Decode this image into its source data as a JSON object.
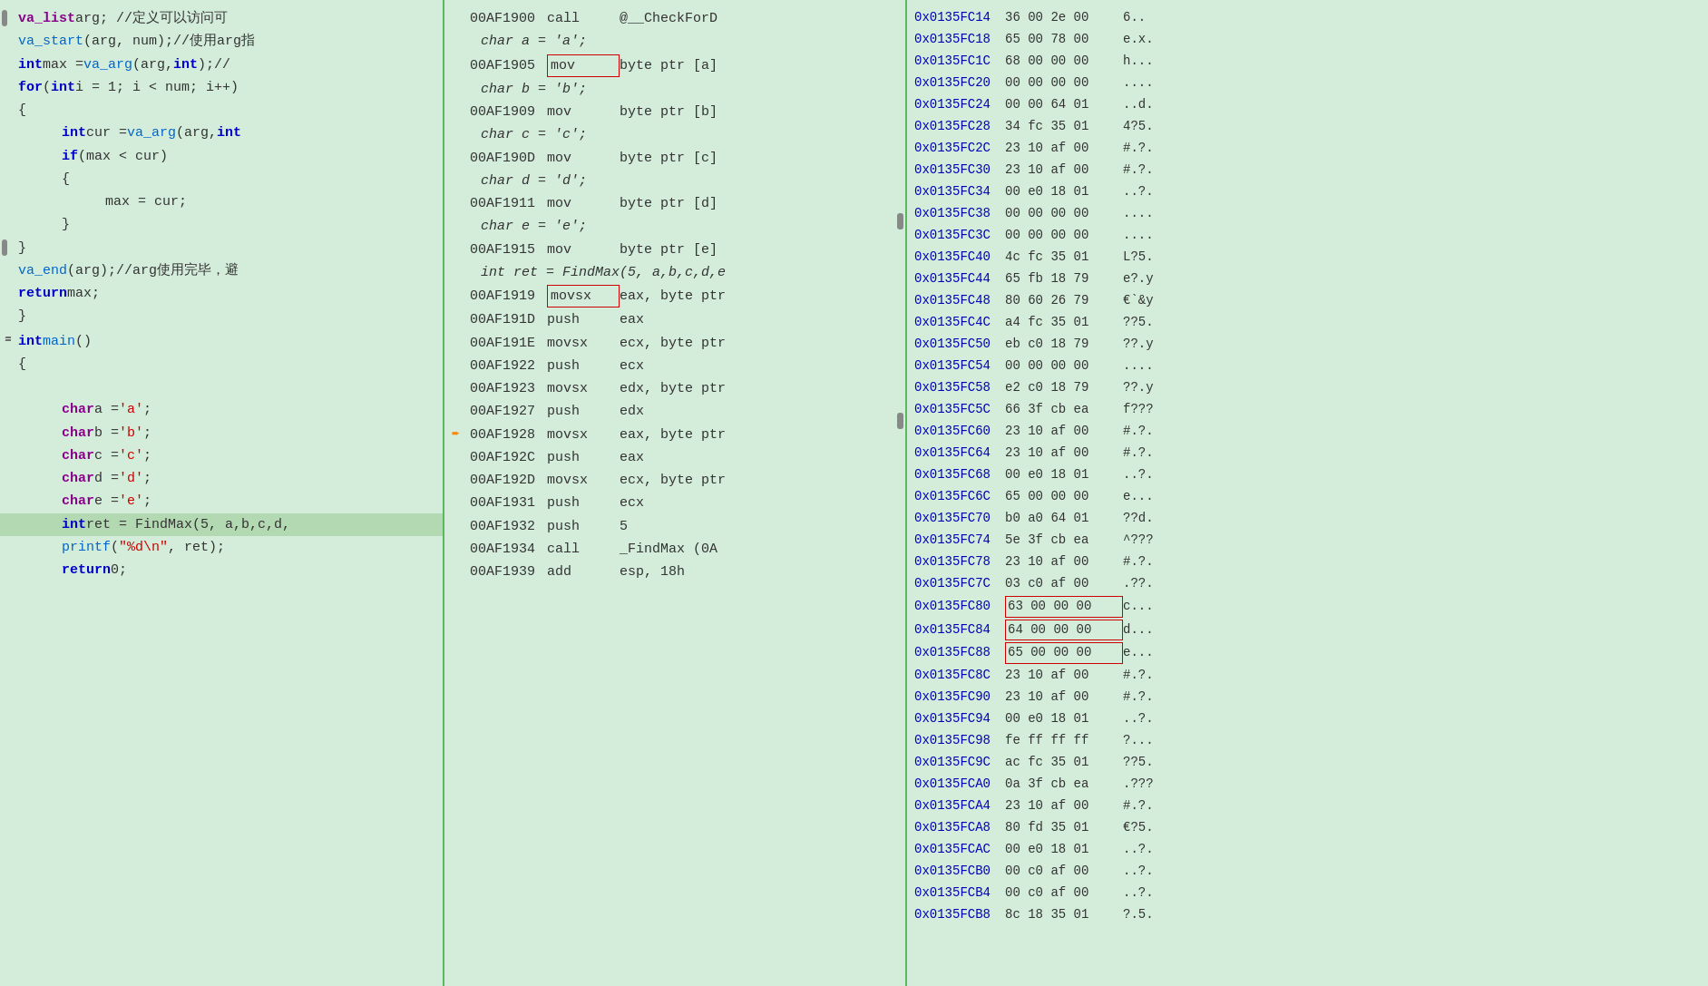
{
  "left": {
    "lines": [
      {
        "id": 1,
        "indent": 0,
        "tokens": [
          {
            "t": "kw2",
            "v": "va_list"
          },
          {
            "t": "plain",
            "v": " arg;   //定义可以访问可"
          }
        ]
      },
      {
        "id": 2,
        "indent": 0,
        "tokens": [
          {
            "t": "fn",
            "v": "va_start"
          },
          {
            "t": "plain",
            "v": "(arg, num);//使用arg指"
          }
        ]
      },
      {
        "id": 3,
        "indent": 0,
        "tokens": [
          {
            "t": "kw",
            "v": "int"
          },
          {
            "t": "plain",
            "v": " max = "
          },
          {
            "t": "fn",
            "v": "va_arg"
          },
          {
            "t": "plain",
            "v": "(arg, "
          },
          {
            "t": "kw",
            "v": "int"
          },
          {
            "t": "plain",
            "v": ");//"
          }
        ]
      },
      {
        "id": 4,
        "indent": 0,
        "tokens": [
          {
            "t": "kw",
            "v": "for"
          },
          {
            "t": "plain",
            "v": " ("
          },
          {
            "t": "kw",
            "v": "int"
          },
          {
            "t": "plain",
            "v": " i = 1; i < num; i++)"
          }
        ]
      },
      {
        "id": 5,
        "indent": 0,
        "tokens": [
          {
            "t": "plain",
            "v": "{"
          }
        ]
      },
      {
        "id": 6,
        "indent": 3,
        "tokens": [
          {
            "t": "kw",
            "v": "int"
          },
          {
            "t": "plain",
            "v": " cur = "
          },
          {
            "t": "fn",
            "v": "va_arg"
          },
          {
            "t": "plain",
            "v": "(arg, "
          },
          {
            "t": "kw",
            "v": "int"
          }
        ]
      },
      {
        "id": 7,
        "indent": 3,
        "tokens": [
          {
            "t": "kw",
            "v": "if"
          },
          {
            "t": "plain",
            "v": " (max < cur)"
          }
        ]
      },
      {
        "id": 8,
        "indent": 3,
        "tokens": [
          {
            "t": "plain",
            "v": "{"
          }
        ]
      },
      {
        "id": 9,
        "indent": 6,
        "tokens": [
          {
            "t": "plain",
            "v": "max = cur;"
          }
        ]
      },
      {
        "id": 10,
        "indent": 3,
        "tokens": [
          {
            "t": "plain",
            "v": "}"
          }
        ]
      },
      {
        "id": 11,
        "indent": 0,
        "tokens": [
          {
            "t": "plain",
            "v": "}"
          }
        ]
      },
      {
        "id": 12,
        "indent": 0,
        "tokens": [
          {
            "t": "fn",
            "v": "va_end"
          },
          {
            "t": "plain",
            "v": "(arg);//arg使用完毕，避"
          }
        ]
      },
      {
        "id": 13,
        "indent": 0,
        "tokens": [
          {
            "t": "kw",
            "v": "return"
          },
          {
            "t": "plain",
            "v": " max;"
          }
        ]
      },
      {
        "id": 14,
        "indent": 0,
        "tokens": [
          {
            "t": "plain",
            "v": "}"
          }
        ]
      },
      {
        "id": 15,
        "indent": 0,
        "tokens": []
      },
      {
        "id": 16,
        "indent": 0,
        "gutter": "=",
        "tokens": [
          {
            "t": "kw",
            "v": "int"
          },
          {
            "t": "plain",
            "v": " "
          },
          {
            "t": "fn",
            "v": "main"
          },
          {
            "t": "plain",
            "v": "()"
          }
        ]
      },
      {
        "id": 17,
        "indent": 0,
        "tokens": [
          {
            "t": "plain",
            "v": "{"
          }
        ]
      },
      {
        "id": 18,
        "indent": 3,
        "tokens": []
      },
      {
        "id": 19,
        "indent": 3,
        "tokens": [
          {
            "t": "kw2",
            "v": "char"
          },
          {
            "t": "plain",
            "v": " a = "
          },
          {
            "t": "str",
            "v": "'a'"
          },
          {
            "t": "plain",
            "v": ";"
          }
        ]
      },
      {
        "id": 20,
        "indent": 3,
        "tokens": [
          {
            "t": "kw2",
            "v": "char"
          },
          {
            "t": "plain",
            "v": " b = "
          },
          {
            "t": "str",
            "v": "'b'"
          },
          {
            "t": "plain",
            "v": ";"
          }
        ]
      },
      {
        "id": 21,
        "indent": 3,
        "tokens": [
          {
            "t": "kw2",
            "v": "char"
          },
          {
            "t": "plain",
            "v": " c = "
          },
          {
            "t": "str",
            "v": "'c'"
          },
          {
            "t": "plain",
            "v": ";"
          }
        ]
      },
      {
        "id": 22,
        "indent": 3,
        "tokens": [
          {
            "t": "kw2",
            "v": "char"
          },
          {
            "t": "plain",
            "v": " d = "
          },
          {
            "t": "str",
            "v": "'d'"
          },
          {
            "t": "plain",
            "v": ";"
          }
        ]
      },
      {
        "id": 23,
        "indent": 3,
        "tokens": [
          {
            "t": "kw2",
            "v": "char"
          },
          {
            "t": "plain",
            "v": " e = "
          },
          {
            "t": "str",
            "v": "'e'"
          },
          {
            "t": "plain",
            "v": ";"
          }
        ]
      },
      {
        "id": 24,
        "indent": 3,
        "highlight": true,
        "tokens": [
          {
            "t": "kw",
            "v": "int"
          },
          {
            "t": "plain",
            "v": " ret = FindMax(5,  a,b,c,d,"
          }
        ]
      },
      {
        "id": 25,
        "indent": 3,
        "tokens": [
          {
            "t": "fn",
            "v": "printf"
          },
          {
            "t": "plain",
            "v": "("
          },
          {
            "t": "str",
            "v": "\"%d\\n\""
          },
          {
            "t": "plain",
            "v": ", ret);"
          }
        ]
      },
      {
        "id": 26,
        "indent": 3,
        "tokens": [
          {
            "t": "kw",
            "v": "return"
          },
          {
            "t": "plain",
            "v": " 0;"
          }
        ]
      }
    ]
  },
  "mid": {
    "lines": [
      {
        "addr": "00AF1900",
        "mnem": "call",
        "ops": "    @__CheckForD",
        "indent": false,
        "arrow": false,
        "mnem_boxed": false
      },
      {
        "addr": "",
        "mnem": "",
        "ops": "char a = 'a';",
        "indent": true,
        "arrow": false,
        "sub": true
      },
      {
        "addr": "00AF1905",
        "mnem": "mov",
        "ops": "byte ptr [a]",
        "indent": false,
        "arrow": false,
        "mnem_boxed": true
      },
      {
        "addr": "",
        "mnem": "",
        "ops": "char b = 'b';",
        "indent": true,
        "arrow": false,
        "sub": true
      },
      {
        "addr": "00AF1909",
        "mnem": "mov",
        "ops": "byte ptr [b]",
        "indent": false,
        "arrow": false,
        "mnem_boxed": false
      },
      {
        "addr": "",
        "mnem": "",
        "ops": "char c = 'c';",
        "indent": true,
        "arrow": false,
        "sub": true
      },
      {
        "addr": "00AF190D",
        "mnem": "mov",
        "ops": "byte ptr [c]",
        "indent": false,
        "arrow": false,
        "mnem_boxed": false
      },
      {
        "addr": "",
        "mnem": "",
        "ops": "char d = 'd';",
        "indent": true,
        "arrow": false,
        "sub": true
      },
      {
        "addr": "00AF1911",
        "mnem": "mov",
        "ops": "byte ptr [d]",
        "indent": false,
        "arrow": false,
        "mnem_boxed": false
      },
      {
        "addr": "",
        "mnem": "",
        "ops": "char e = 'e';",
        "indent": true,
        "arrow": false,
        "sub": true
      },
      {
        "addr": "00AF1915",
        "mnem": "mov",
        "ops": "byte ptr [e]",
        "indent": false,
        "arrow": false,
        "mnem_boxed": false
      },
      {
        "addr": "",
        "mnem": "",
        "ops": "int ret = FindMax(5,  a,b,c,d,e",
        "indent": true,
        "arrow": false,
        "sub": true
      },
      {
        "addr": "00AF1919",
        "mnem": "movsx",
        "ops": "eax, byte ptr",
        "indent": false,
        "arrow": false,
        "mnem_boxed": true
      },
      {
        "addr": "00AF191D",
        "mnem": "push",
        "ops": "eax",
        "indent": false,
        "arrow": false,
        "mnem_boxed": false
      },
      {
        "addr": "00AF191E",
        "mnem": "movsx",
        "ops": "ecx, byte ptr",
        "indent": false,
        "arrow": false,
        "mnem_boxed": false
      },
      {
        "addr": "00AF1922",
        "mnem": "push",
        "ops": "ecx",
        "indent": false,
        "arrow": false,
        "mnem_boxed": false
      },
      {
        "addr": "00AF1923",
        "mnem": "movsx",
        "ops": "edx, byte ptr",
        "indent": false,
        "arrow": false,
        "mnem_boxed": false
      },
      {
        "addr": "00AF1927",
        "mnem": "push",
        "ops": "edx",
        "indent": false,
        "arrow": false,
        "mnem_boxed": false
      },
      {
        "addr": "00AF1928",
        "mnem": "movsx",
        "ops": "eax, byte ptr",
        "indent": false,
        "arrow": true,
        "mnem_boxed": false
      },
      {
        "addr": "00AF192C",
        "mnem": "push",
        "ops": "eax",
        "indent": false,
        "arrow": false,
        "mnem_boxed": false
      },
      {
        "addr": "00AF192D",
        "mnem": "movsx",
        "ops": "ecx, byte ptr",
        "indent": false,
        "arrow": false,
        "mnem_boxed": false
      },
      {
        "addr": "00AF1931",
        "mnem": "push",
        "ops": "ecx",
        "indent": false,
        "arrow": false,
        "mnem_boxed": false
      },
      {
        "addr": "00AF1932",
        "mnem": "push",
        "ops": "5",
        "indent": false,
        "arrow": false,
        "mnem_boxed": false
      },
      {
        "addr": "00AF1934",
        "mnem": "call",
        "ops": "_FindMax (0A",
        "indent": false,
        "arrow": false,
        "mnem_boxed": false
      },
      {
        "addr": "00AF1939",
        "mnem": "add",
        "ops": "esp, 18h",
        "indent": false,
        "arrow": false,
        "mnem_boxed": false
      }
    ]
  },
  "right": {
    "lines": [
      {
        "addr": "0x0135FC14",
        "bytes": "36 00 2e 00",
        "ascii": "6.."
      },
      {
        "addr": "0x0135FC18",
        "bytes": "65 00 78 00",
        "ascii": "e.x."
      },
      {
        "addr": "0x0135FC1C",
        "bytes": "68 00 00 00",
        "ascii": "h..."
      },
      {
        "addr": "0x0135FC20",
        "bytes": "00 00 00 00",
        "ascii": "...."
      },
      {
        "addr": "0x0135FC24",
        "bytes": "00 00 64 01",
        "ascii": "..d."
      },
      {
        "addr": "0x0135FC28",
        "bytes": "34 fc 35 01",
        "ascii": "4?5."
      },
      {
        "addr": "0x0135FC2C",
        "bytes": "23 10 af 00",
        "ascii": "#.?."
      },
      {
        "addr": "0x0135FC30",
        "bytes": "23 10 af 00",
        "ascii": "#.?."
      },
      {
        "addr": "0x0135FC34",
        "bytes": "00 e0 18 01",
        "ascii": "..?."
      },
      {
        "addr": "0x0135FC38",
        "bytes": "00 00 00 00",
        "ascii": "...."
      },
      {
        "addr": "0x0135FC3C",
        "bytes": "00 00 00 00",
        "ascii": "...."
      },
      {
        "addr": "0x0135FC40",
        "bytes": "4c fc 35 01",
        "ascii": "L?5."
      },
      {
        "addr": "0x0135FC44",
        "bytes": "65 fb 18 79",
        "ascii": "e?.y"
      },
      {
        "addr": "0x0135FC48",
        "bytes": "80 60 26 79",
        "ascii": "€`&y"
      },
      {
        "addr": "0x0135FC4C",
        "bytes": "a4 fc 35 01",
        "ascii": "??5."
      },
      {
        "addr": "0x0135FC50",
        "bytes": "eb c0 18 79",
        "ascii": "??.y"
      },
      {
        "addr": "0x0135FC54",
        "bytes": "00 00 00 00",
        "ascii": "...."
      },
      {
        "addr": "0x0135FC58",
        "bytes": "e2 c0 18 79",
        "ascii": "??.y"
      },
      {
        "addr": "0x0135FC5C",
        "bytes": "66 3f cb ea",
        "ascii": "f???"
      },
      {
        "addr": "0x0135FC60",
        "bytes": "23 10 af 00",
        "ascii": "#.?."
      },
      {
        "addr": "0x0135FC64",
        "bytes": "23 10 af 00",
        "ascii": "#.?."
      },
      {
        "addr": "0x0135FC68",
        "bytes": "00 e0 18 01",
        "ascii": "..?."
      },
      {
        "addr": "0x0135FC6C",
        "bytes": "65 00 00 00",
        "ascii": "e..."
      },
      {
        "addr": "0x0135FC70",
        "bytes": "b0 a0 64 01",
        "ascii": "??d."
      },
      {
        "addr": "0x0135FC74",
        "bytes": "5e 3f cb ea",
        "ascii": "^???"
      },
      {
        "addr": "0x0135FC78",
        "bytes": "23 10 af 00",
        "ascii": "#.?."
      },
      {
        "addr": "0x0135FC7C",
        "bytes": "03 c0 af 00",
        "ascii": ".??."
      },
      {
        "addr": "0x0135FC80",
        "bytes": "63 00 00 00",
        "ascii": "c...",
        "boxed": true
      },
      {
        "addr": "0x0135FC84",
        "bytes": "64 00 00 00",
        "ascii": "d...",
        "boxed": true
      },
      {
        "addr": "0x0135FC88",
        "bytes": "65 00 00 00",
        "ascii": "e...",
        "boxed": true
      },
      {
        "addr": "0x0135FC8C",
        "bytes": "23 10 af 00",
        "ascii": "#.?."
      },
      {
        "addr": "0x0135FC90",
        "bytes": "23 10 af 00",
        "ascii": "#.?."
      },
      {
        "addr": "0x0135FC94",
        "bytes": "00 e0 18 01",
        "ascii": "..?."
      },
      {
        "addr": "0x0135FC98",
        "bytes": "fe ff ff ff",
        "ascii": "?..."
      },
      {
        "addr": "0x0135FC9C",
        "bytes": "ac fc 35 01",
        "ascii": "??5."
      },
      {
        "addr": "0x0135FCA0",
        "bytes": "0a 3f cb ea",
        "ascii": ".???"
      },
      {
        "addr": "0x0135FCA4",
        "bytes": "23 10 af 00",
        "ascii": "#.?."
      },
      {
        "addr": "0x0135FCA8",
        "bytes": "80 fd 35 01",
        "ascii": "€?5."
      },
      {
        "addr": "0x0135FCAC",
        "bytes": "00 e0 18 01",
        "ascii": "..?."
      },
      {
        "addr": "0x0135FCB0",
        "bytes": "00 c0 af 00",
        "ascii": "..?."
      },
      {
        "addr": "0x0135FCB4",
        "bytes": "00 c0 af 00",
        "ascii": "..?."
      },
      {
        "addr": "0x0135FCB8",
        "bytes": "8c 18 35 01",
        "ascii": "?.5."
      }
    ]
  }
}
